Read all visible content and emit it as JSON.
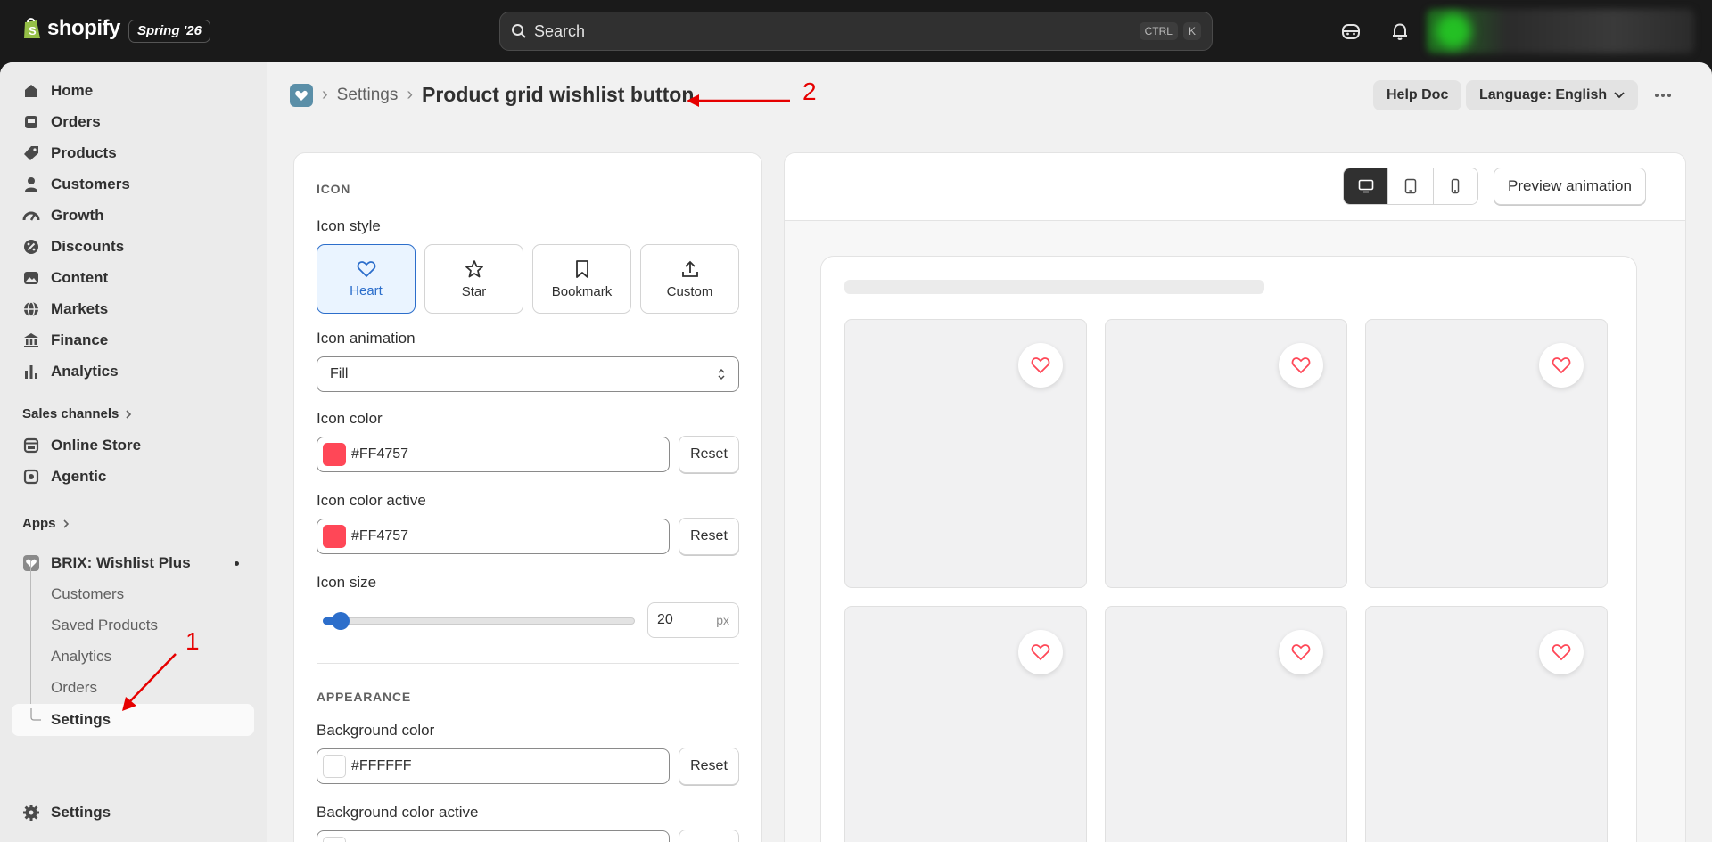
{
  "topbar": {
    "logo_text": "shopify",
    "edition_badge": "Spring '26",
    "search_placeholder": "Search",
    "shortcut_ctrl": "CTRL",
    "shortcut_key": "K"
  },
  "sidebar": {
    "items": [
      {
        "label": "Home",
        "icon": "home-icon"
      },
      {
        "label": "Orders",
        "icon": "inbox-icon"
      },
      {
        "label": "Products",
        "icon": "tag-icon"
      },
      {
        "label": "Customers",
        "icon": "person-icon"
      },
      {
        "label": "Growth",
        "icon": "gauge-icon"
      },
      {
        "label": "Discounts",
        "icon": "discount-icon"
      },
      {
        "label": "Content",
        "icon": "image-icon"
      },
      {
        "label": "Markets",
        "icon": "globe-icon"
      },
      {
        "label": "Finance",
        "icon": "bank-icon"
      },
      {
        "label": "Analytics",
        "icon": "bar-chart-icon"
      }
    ],
    "sales_channels_label": "Sales channels",
    "channels": [
      {
        "label": "Online Store",
        "icon": "store-icon"
      },
      {
        "label": "Agentic",
        "icon": "agentic-icon"
      }
    ],
    "apps_label": "Apps",
    "app_name": "BRIX: Wishlist Plus",
    "app_subitems": [
      "Customers",
      "Saved Products",
      "Analytics",
      "Orders",
      "Settings"
    ],
    "settings_label": "Settings"
  },
  "header": {
    "crumb_parent": "Settings",
    "crumb_sep": "›",
    "title": "Product grid wishlist button",
    "help_button": "Help Doc",
    "language_button": "Language: English",
    "more_label": "···"
  },
  "form": {
    "icon_section": "ICON",
    "icon_style_label": "Icon style",
    "style_options": [
      "Heart",
      "Star",
      "Bookmark",
      "Custom"
    ],
    "icon_animation_label": "Icon animation",
    "icon_animation_value": "Fill",
    "icon_color_label": "Icon color",
    "icon_color_value": "#FF4757",
    "icon_color_active_label": "Icon color active",
    "icon_color_active_value": "#FF4757",
    "reset_label": "Reset",
    "icon_size_label": "Icon size",
    "icon_size_value": "20",
    "icon_size_unit": "px",
    "icon_size_slider_fraction": 0.05,
    "appearance_section": "APPEARANCE",
    "bg_color_label": "Background color",
    "bg_color_value": "#FFFFFF",
    "bg_color_active_label": "Background color active"
  },
  "preview": {
    "preview_button": "Preview animation"
  },
  "annotations": {
    "marker_1": "1",
    "marker_2": "2"
  },
  "colors": {
    "accent_blue": "#2c6ecb",
    "icon_red": "#FF4757",
    "annotation_red": "#e60000"
  }
}
